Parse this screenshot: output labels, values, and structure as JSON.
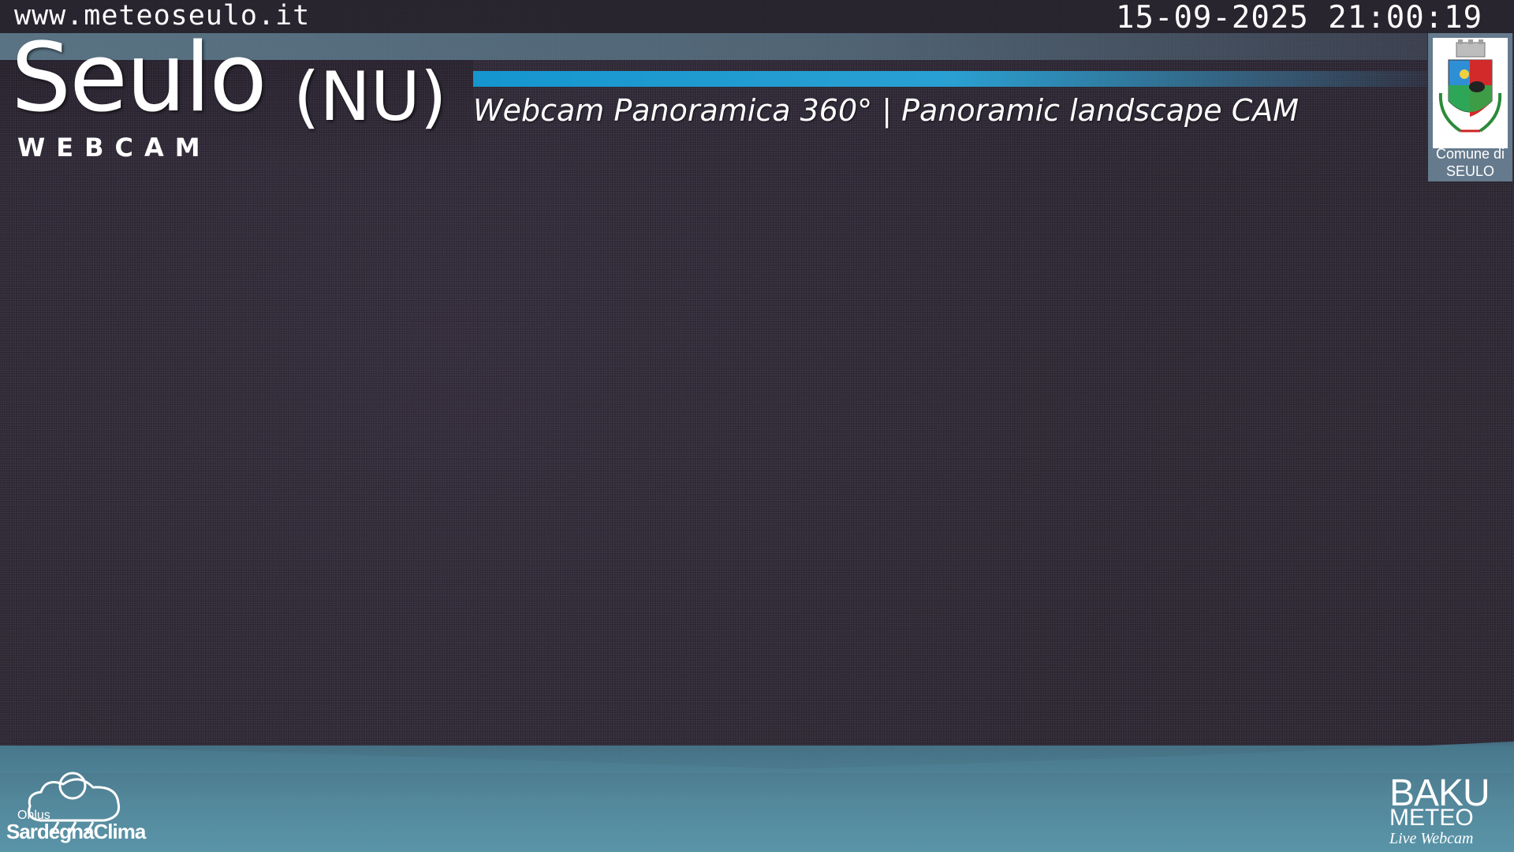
{
  "overlay": {
    "url": "www.meteoseulo.it",
    "timestamp": "15-09-2025 21:00:19",
    "town": "Seulo",
    "province": "(NU)",
    "webcam_label": "WEBCAM",
    "subtitle": "Webcam Panoramica 360°  | Panoramic landscape CAM",
    "crest_caption_line1": "Comune di",
    "crest_caption_line2": "SEULO",
    "crest_icon": "coat-of-arms-icon"
  },
  "sponsors": {
    "left_onlus": "Onlus",
    "left_name": "SardegnaClima",
    "left_icon": "sun-cloud-rain-icon",
    "right_line1": "BAKU",
    "right_line2": "METEO",
    "right_line3": "Live Webcam"
  },
  "colors": {
    "accent": "#1596cf",
    "sky": "#2b2630",
    "band": "#5a94a8"
  }
}
